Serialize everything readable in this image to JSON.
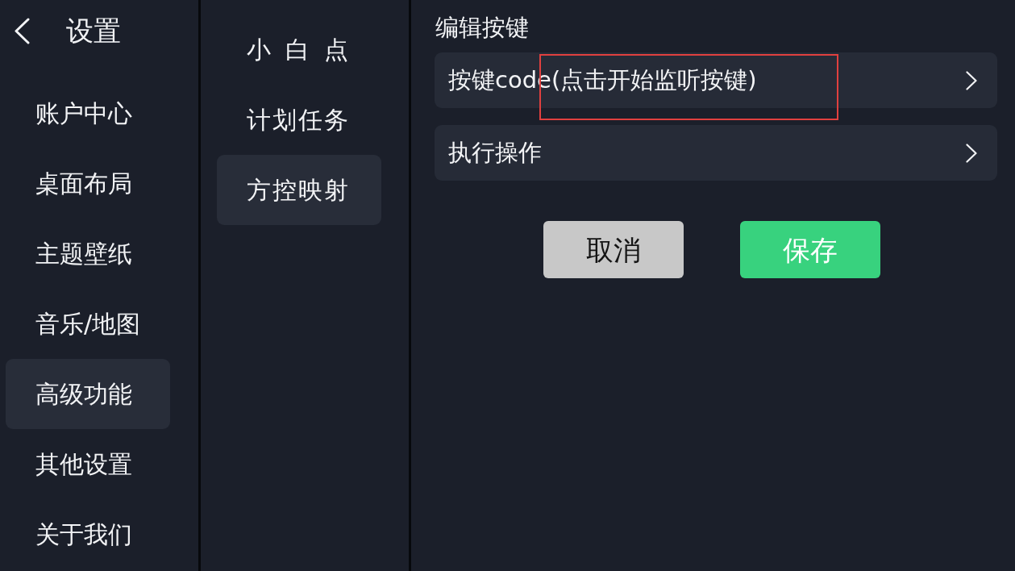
{
  "header": {
    "title": "设置"
  },
  "sidebar": {
    "items": [
      {
        "label": "账户中心",
        "selected": false
      },
      {
        "label": "桌面布局",
        "selected": false
      },
      {
        "label": "主题壁纸",
        "selected": false
      },
      {
        "label": "音乐/地图",
        "selected": false
      },
      {
        "label": "高级功能",
        "selected": true
      },
      {
        "label": "其他设置",
        "selected": false
      },
      {
        "label": "关于我们",
        "selected": false
      }
    ]
  },
  "submenu": {
    "items": [
      {
        "label": "小 白 点",
        "selected": false
      },
      {
        "label": "计划任务",
        "selected": false
      },
      {
        "label": "方控映射",
        "selected": true
      }
    ]
  },
  "editor": {
    "title": "编辑按键",
    "rows": [
      {
        "label": "按键code(点击开始监听按键)",
        "annotated": true
      },
      {
        "label": "执行操作",
        "annotated": false
      }
    ],
    "buttons": [
      {
        "label": "取消",
        "kind": "cancel"
      },
      {
        "label": "保存",
        "kind": "save"
      }
    ]
  }
}
